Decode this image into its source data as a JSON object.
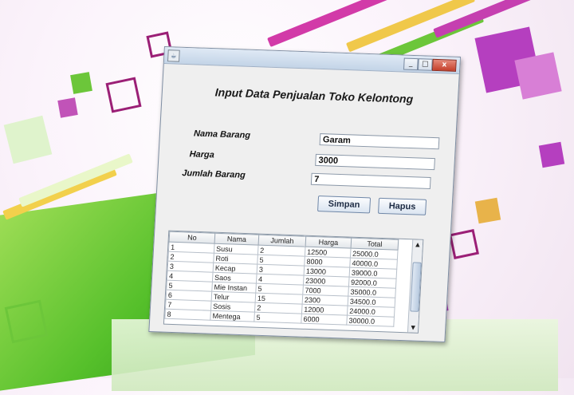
{
  "window": {
    "icon": "java-cup-icon",
    "controls": [
      "minimize-icon",
      "maximize-icon",
      "close-icon"
    ],
    "close_glyph": "x"
  },
  "form": {
    "title": "Input Data Penjualan Toko Kelontong",
    "labels": {
      "nama_barang": "Nama Barang",
      "harga": "Harga",
      "jumlah_barang": "Jumlah Barang"
    },
    "fields": {
      "nama_barang": "Garam",
      "harga": "3000",
      "jumlah_barang": "7"
    },
    "buttons": {
      "simpan": "Simpan",
      "hapus": "Hapus"
    }
  },
  "table": {
    "columns": [
      "No",
      "Nama",
      "Jumlah",
      "Harga",
      "Total"
    ],
    "rows": [
      [
        "1",
        "Susu",
        "2",
        "12500",
        "25000.0"
      ],
      [
        "2",
        "Roti",
        "5",
        "8000",
        "40000.0"
      ],
      [
        "3",
        "Kecap",
        "3",
        "13000",
        "39000.0"
      ],
      [
        "4",
        "Saos",
        "4",
        "23000",
        "92000.0"
      ],
      [
        "5",
        "Mie Instan",
        "5",
        "7000",
        "35000.0"
      ],
      [
        "6",
        "Telur",
        "15",
        "2300",
        "34500.0"
      ],
      [
        "7",
        "Sosis",
        "2",
        "12000",
        "24000.0"
      ],
      [
        "8",
        "Mentega",
        "5",
        "6000",
        "30000.0"
      ]
    ],
    "scroll_up_glyph": "▲",
    "scroll_down_glyph": "▼"
  },
  "colors": {
    "accent_green": "#56c02b",
    "accent_magenta": "#b5279a"
  }
}
